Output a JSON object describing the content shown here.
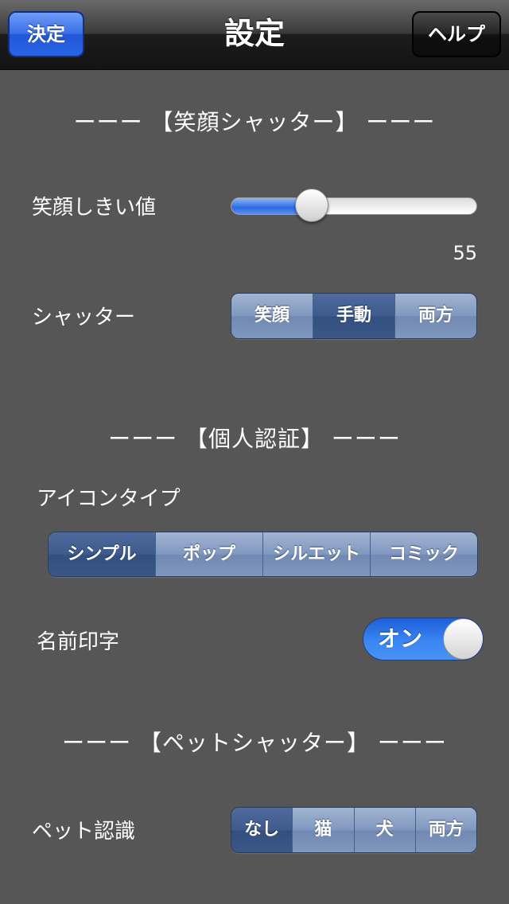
{
  "nav": {
    "title": "設定",
    "done_label": "決定",
    "help_label": "ヘルプ"
  },
  "smile_section": {
    "header": "ーーー 【笑顔シャッター】 ーーー",
    "threshold_label": "笑顔しきい値",
    "threshold_value": "55",
    "threshold_fraction": 0.33,
    "shutter_label": "シャッター",
    "shutter_options": [
      "笑顔",
      "手動",
      "両方"
    ],
    "shutter_selected": "手動"
  },
  "auth_section": {
    "header": "ーーー 【個人認証】 ーーー",
    "icon_type_label": "アイコンタイプ",
    "icon_type_options": [
      "シンプル",
      "ポップ",
      "シルエット",
      "コミック"
    ],
    "icon_type_selected": "シンプル",
    "name_print_label": "名前印字",
    "name_print_toggle_label": "オン",
    "name_print_on": true
  },
  "pet_section": {
    "header": "ーーー 【ペットシャッター】 ーーー",
    "pet_detect_label": "ペット認識",
    "pet_detect_options": [
      "なし",
      "猫",
      "犬",
      "両方"
    ],
    "pet_detect_selected": "なし"
  },
  "colors": {
    "background": "#565656",
    "accent_blue": "#2d6be4",
    "segment_selected": "#3f5a8c",
    "segment_normal": "#8197bd"
  }
}
